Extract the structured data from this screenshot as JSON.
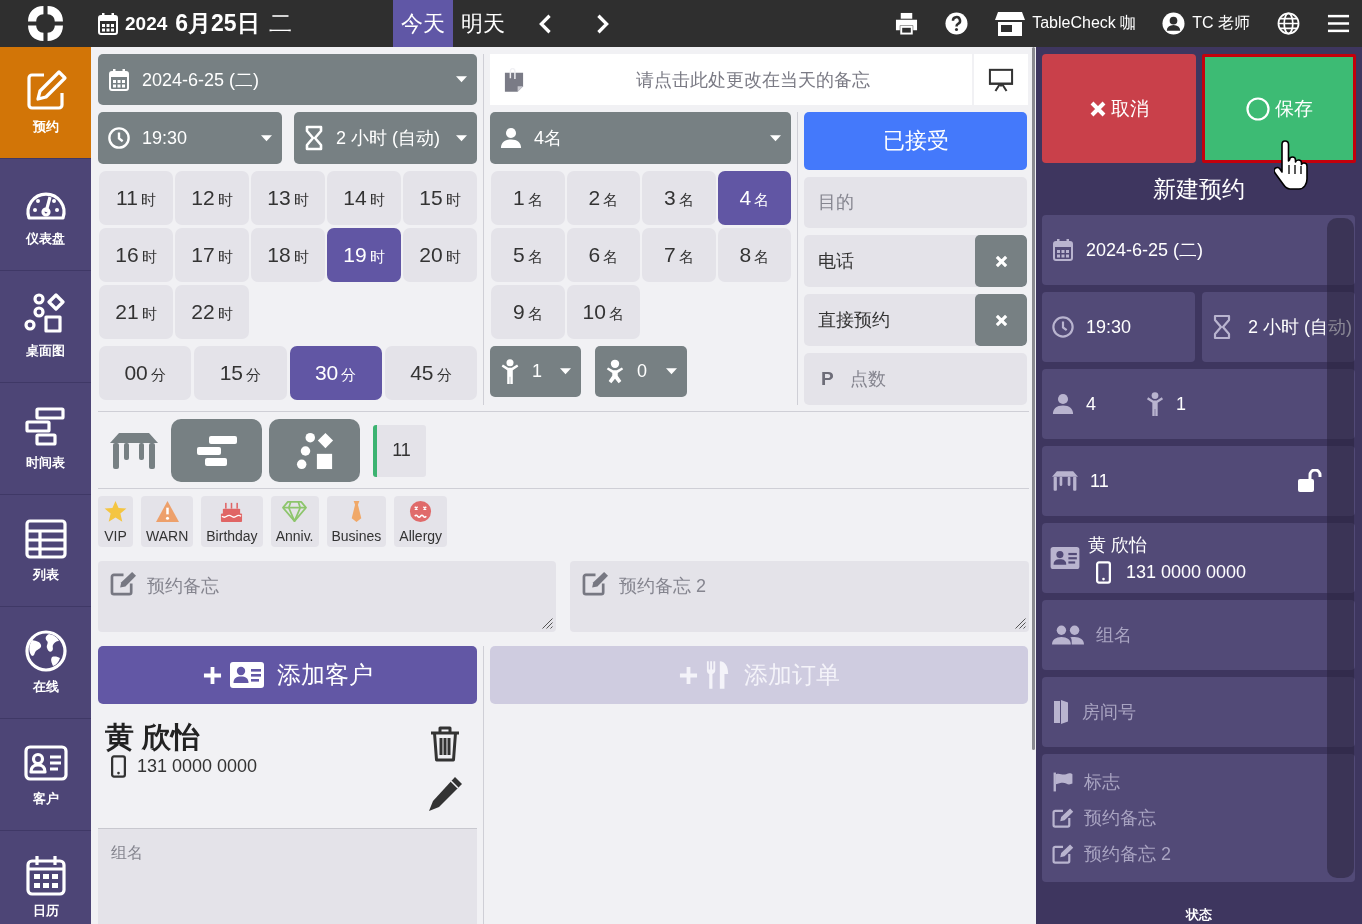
{
  "top_bar": {
    "date": {
      "year": "2024",
      "month_day": "6月25日",
      "weekday": "二"
    },
    "day_tabs": [
      {
        "label": "今天",
        "selected": true
      },
      {
        "label": "明天",
        "selected": false
      }
    ],
    "shop": "TableCheck 咖",
    "user": "TC 老师"
  },
  "sidebar": {
    "items": [
      {
        "label": "预约",
        "selected": true
      },
      {
        "label": "仪表盘",
        "selected": false
      },
      {
        "label": "桌面图",
        "selected": false
      },
      {
        "label": "时间表",
        "selected": false
      },
      {
        "label": "列表",
        "selected": false
      },
      {
        "label": "在线",
        "selected": false
      },
      {
        "label": "客户",
        "selected": false
      },
      {
        "label": "日历",
        "selected": false
      }
    ]
  },
  "booking_form": {
    "date_select": {
      "value": "2024-6-25 (二)"
    },
    "time_select": {
      "value": "19:30"
    },
    "duration_select": {
      "value": "2 小时 (自动)"
    },
    "hour_options": [
      {
        "number": "11",
        "unit": "时",
        "selected": false
      },
      {
        "number": "12",
        "unit": "时",
        "selected": false
      },
      {
        "number": "13",
        "unit": "时",
        "selected": false
      },
      {
        "number": "14",
        "unit": "时",
        "selected": false
      },
      {
        "number": "15",
        "unit": "时",
        "selected": false
      },
      {
        "number": "16",
        "unit": "时",
        "selected": false
      },
      {
        "number": "17",
        "unit": "时",
        "selected": false
      },
      {
        "number": "18",
        "unit": "时",
        "selected": false
      },
      {
        "number": "19",
        "unit": "时",
        "selected": true
      },
      {
        "number": "20",
        "unit": "时",
        "selected": false
      },
      {
        "number": "21",
        "unit": "时",
        "selected": false
      },
      {
        "number": "22",
        "unit": "时",
        "selected": false
      }
    ],
    "minute_options": [
      {
        "number": "00",
        "unit": "分",
        "selected": false
      },
      {
        "number": "15",
        "unit": "分",
        "selected": false
      },
      {
        "number": "30",
        "unit": "分",
        "selected": true
      },
      {
        "number": "45",
        "unit": "分",
        "selected": false
      }
    ],
    "day_memo": {
      "placeholder": "请点击此处更改在当天的备忘"
    },
    "party_select": {
      "value": "4名"
    },
    "party_options": [
      {
        "number": "1",
        "unit": "名",
        "selected": false
      },
      {
        "number": "2",
        "unit": "名",
        "selected": false
      },
      {
        "number": "3",
        "unit": "名",
        "selected": false
      },
      {
        "number": "4",
        "unit": "名",
        "selected": true
      },
      {
        "number": "5",
        "unit": "名",
        "selected": false
      },
      {
        "number": "6",
        "unit": "名",
        "selected": false
      },
      {
        "number": "7",
        "unit": "名",
        "selected": false
      },
      {
        "number": "8",
        "unit": "名",
        "selected": false
      },
      {
        "number": "9",
        "unit": "名",
        "selected": false
      },
      {
        "number": "10",
        "unit": "名",
        "selected": false
      }
    ],
    "child_select": {
      "value": "1"
    },
    "baby_select": {
      "value": "0"
    },
    "status_button": {
      "label": "已接受"
    },
    "purpose_field": {
      "placeholder": "目的"
    },
    "source_tags": [
      {
        "label": "电话"
      },
      {
        "label": "直接预约"
      }
    ],
    "points_field": {
      "symbol": "P",
      "placeholder": "点数"
    },
    "table_number": "11",
    "tags": [
      {
        "label": "VIP",
        "selected": false
      },
      {
        "label": "WARN",
        "selected": false
      },
      {
        "label": "Birthday",
        "selected": false
      },
      {
        "label": "Anniv.",
        "selected": false
      },
      {
        "label": "Busines",
        "selected": false
      },
      {
        "label": "Allergy",
        "selected": false
      }
    ],
    "memo_fields": [
      {
        "placeholder": "预约备忘"
      },
      {
        "placeholder": "预约备忘 2"
      }
    ],
    "add_customer_button": {
      "label": "添加客户"
    },
    "add_order_button": {
      "label": "添加订单",
      "disabled": true
    },
    "customer": {
      "name": "黄 欣怡",
      "phone": "131 0000 0000"
    },
    "group_field": {
      "placeholder": "组名"
    }
  },
  "summary": {
    "cancel_button": {
      "label": "取消"
    },
    "save_button": {
      "label": "保存",
      "focused": true
    },
    "title": "新建预约",
    "date": "2024-6-25 (二)",
    "time": "19:30",
    "duration": "2 小时 (自动)",
    "adults": "4",
    "children": "1",
    "table": {
      "number": "11",
      "locked": false
    },
    "guest": {
      "name": "黄 欣怡",
      "phone": "131 0000 0000"
    },
    "group": {
      "text": "组名",
      "empty": true
    },
    "room": {
      "text": "房间号",
      "empty": true
    },
    "notes": [
      {
        "text": "标志",
        "empty": true
      },
      {
        "text": "预约备忘",
        "empty": true
      },
      {
        "text": "预约备忘 2",
        "empty": true
      }
    ],
    "footer": "状态"
  }
}
